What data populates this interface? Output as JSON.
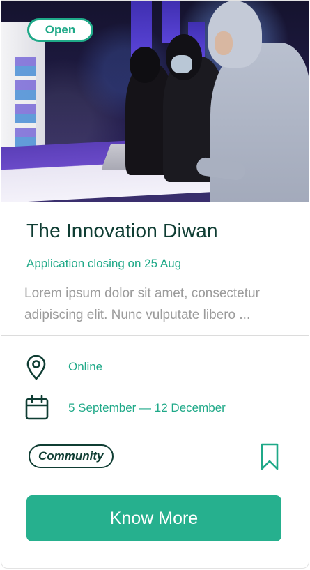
{
  "status_badge": "Open",
  "title": "The Innovation Diwan",
  "closing_text": "Application closing on 25 Aug",
  "description": "Lorem ipsum dolor sit amet, consectetur adipiscing elit. Nunc vulputate libero ...",
  "location": {
    "icon": "location-pin-icon",
    "text": "Online"
  },
  "dates": {
    "icon": "calendar-icon",
    "text": "5 September — 12 December"
  },
  "tag": "Community",
  "bookmark_icon": "bookmark-icon",
  "cta_label": "Know More",
  "colors": {
    "accent": "#1fa988",
    "button": "#26b08e",
    "title": "#0f3d33",
    "muted_text": "#9b9b9b"
  }
}
